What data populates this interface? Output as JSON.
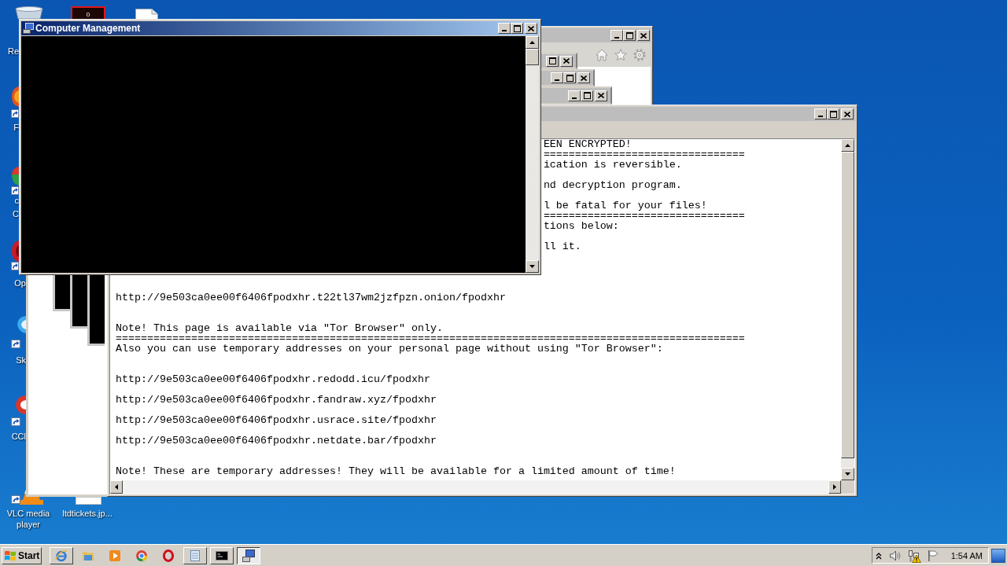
{
  "desktop": {
    "recycle_bin": {
      "label": "Re"
    },
    "counter_icon": {
      "text": "0"
    },
    "shortcuts": [
      {
        "label": "F",
        "shortcut": true
      },
      {
        "label": "c C",
        "shortcut": true
      },
      {
        "label": "Op",
        "shortcut": true
      },
      {
        "label": "Sk",
        "shortcut": true
      },
      {
        "label": "CCl",
        "shortcut": true
      },
      {
        "label": "VLC media player",
        "shortcut": true
      },
      {
        "label": "ltdtickets.jp...",
        "shortcut": false
      }
    ]
  },
  "computer_management_window": {
    "title": "Computer Management"
  },
  "note_window": {
    "lines": [
      {
        "kind": "partial",
        "text": "EEN ENCRYPTED!"
      },
      {
        "kind": "partial",
        "text": "================================"
      },
      {
        "kind": "partial",
        "text": "ication is reversible."
      },
      {
        "kind": "blank"
      },
      {
        "kind": "partial",
        "text": "nd decryption program."
      },
      {
        "kind": "blank"
      },
      {
        "kind": "partial",
        "text": "l be fatal for your files!"
      },
      {
        "kind": "partial",
        "text": "================================"
      },
      {
        "kind": "partial",
        "text": "tions below:"
      },
      {
        "kind": "blank"
      },
      {
        "kind": "partial",
        "text": "ll it."
      },
      {
        "kind": "blank"
      },
      {
        "kind": "blank"
      },
      {
        "kind": "blank"
      },
      {
        "kind": "blank"
      },
      {
        "kind": "full",
        "text": "http://9e503ca0ee00f6406fpodxhr.t22tl37wm2jzfpzn.onion/fpodxhr"
      },
      {
        "kind": "blank"
      },
      {
        "kind": "blank"
      },
      {
        "kind": "full",
        "text": "Note! This page is available via \"Tor Browser\" only."
      },
      {
        "kind": "full",
        "text": "===================================================================================================="
      },
      {
        "kind": "full",
        "text": "Also you can use temporary addresses on your personal page without using \"Tor Browser\":"
      },
      {
        "kind": "blank"
      },
      {
        "kind": "blank"
      },
      {
        "kind": "full",
        "text": "http://9e503ca0ee00f6406fpodxhr.redodd.icu/fpodxhr"
      },
      {
        "kind": "blank"
      },
      {
        "kind": "full",
        "text": "http://9e503ca0ee00f6406fpodxhr.fandraw.xyz/fpodxhr"
      },
      {
        "kind": "blank"
      },
      {
        "kind": "full",
        "text": "http://9e503ca0ee00f6406fpodxhr.usrace.site/fpodxhr"
      },
      {
        "kind": "blank"
      },
      {
        "kind": "full",
        "text": "http://9e503ca0ee00f6406fpodxhr.netdate.bar/fpodxhr"
      },
      {
        "kind": "blank"
      },
      {
        "kind": "blank"
      },
      {
        "kind": "full",
        "text": "Note! These are temporary addresses! They will be available for a limited amount of time!"
      }
    ]
  },
  "taskbar": {
    "start_button": "Start",
    "items": [
      {
        "kind": "window",
        "selected": false
      },
      {
        "kind": "pinned",
        "selected": false
      },
      {
        "kind": "pinned",
        "selected": false
      },
      {
        "kind": "pinned",
        "selected": false
      },
      {
        "kind": "pinned",
        "selected": false
      },
      {
        "kind": "window",
        "selected": false
      },
      {
        "kind": "window",
        "selected": false
      },
      {
        "kind": "window",
        "selected": true
      }
    ],
    "clock": "1:54 AM"
  }
}
